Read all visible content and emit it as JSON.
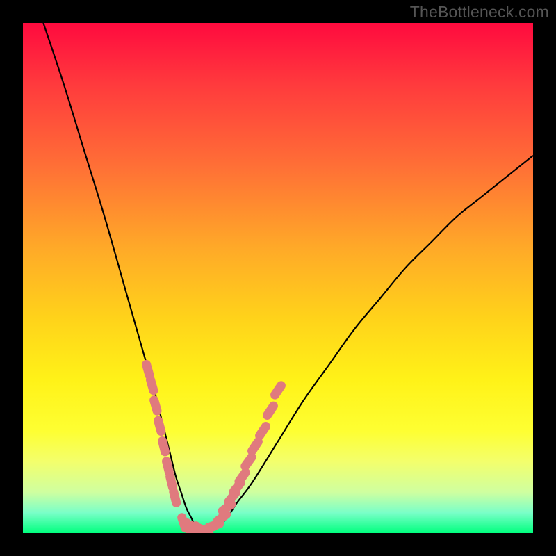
{
  "watermark": "TheBottleneck.com",
  "colors": {
    "frame": "#000000",
    "curve_stroke": "#000000",
    "marker_fill": "#e07a7e",
    "gradient_stops": [
      "#ff0a3e",
      "#ff3a3d",
      "#ff6f36",
      "#ffa928",
      "#ffd31a",
      "#fff218",
      "#feff32",
      "#f3ff6c",
      "#cfffa0",
      "#7affc8",
      "#00ff7e"
    ]
  },
  "chart_data": {
    "type": "line",
    "title": "",
    "xlabel": "",
    "ylabel": "",
    "xlim": [
      0,
      100
    ],
    "ylim": [
      0,
      100
    ],
    "grid": false,
    "series": [
      {
        "name": "bottleneck-curve",
        "x": [
          4,
          8,
          12,
          16,
          20,
          22,
          24,
          26,
          27,
          28,
          29,
          30,
          31,
          32,
          33,
          34,
          35,
          36,
          38,
          40,
          42,
          45,
          50,
          55,
          60,
          65,
          70,
          75,
          80,
          85,
          90,
          95,
          100
        ],
        "y": [
          100,
          88,
          75,
          62,
          48,
          41,
          34,
          27,
          23,
          19,
          15,
          11,
          8,
          5,
          3,
          1,
          0,
          0,
          1,
          3,
          6,
          10,
          18,
          26,
          33,
          40,
          46,
          52,
          57,
          62,
          66,
          70,
          74
        ]
      }
    ],
    "markers": [
      {
        "name": "left-cluster",
        "x": [
          24.5,
          25.3,
          26.0,
          26.8,
          27.6,
          28.4,
          29.1,
          29.8
        ],
        "y": [
          32,
          29,
          25,
          21,
          17,
          13,
          10,
          7
        ]
      },
      {
        "name": "valley-floor",
        "x": [
          31.5,
          32.5,
          33.5,
          34.5,
          35.5,
          36.5,
          37.5
        ],
        "y": [
          2,
          1,
          0.5,
          0.5,
          0.5,
          1,
          1.5
        ]
      },
      {
        "name": "right-cluster",
        "x": [
          39.0,
          40.0,
          41.0,
          42.0,
          43.0,
          44.2,
          45.5,
          47.0,
          48.5,
          50.0
        ],
        "y": [
          3,
          5,
          7,
          9,
          11,
          14,
          17,
          20,
          24,
          28
        ]
      }
    ]
  }
}
